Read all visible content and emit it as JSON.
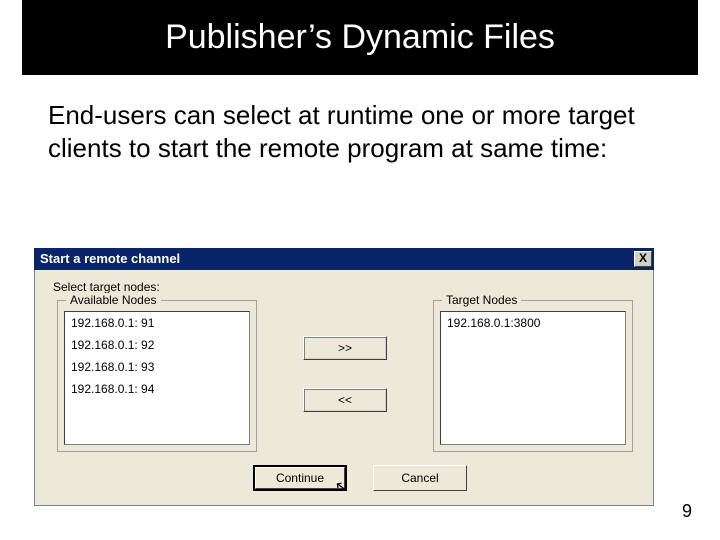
{
  "slide": {
    "title": "Publisher’s Dynamic Files",
    "body": "End-users can select at runtime one or more target clients to start the remote program at same time:",
    "page_number": "9"
  },
  "dialog": {
    "title": "Start a remote channel",
    "close_label": "X",
    "instruction": "Select target nodes:",
    "available_legend": "Available Nodes",
    "target_legend": "Target Nodes",
    "available_nodes": [
      "192.168.0.1: 91",
      "192.168.0.1: 92",
      "192.168.0.1: 93",
      "192.168.0.1: 94"
    ],
    "target_nodes": [
      "192.168.0.1:3800"
    ],
    "add_label": ">>",
    "remove_label": "<<",
    "continue_label": "Continue",
    "cancel_label": "Cancel"
  }
}
